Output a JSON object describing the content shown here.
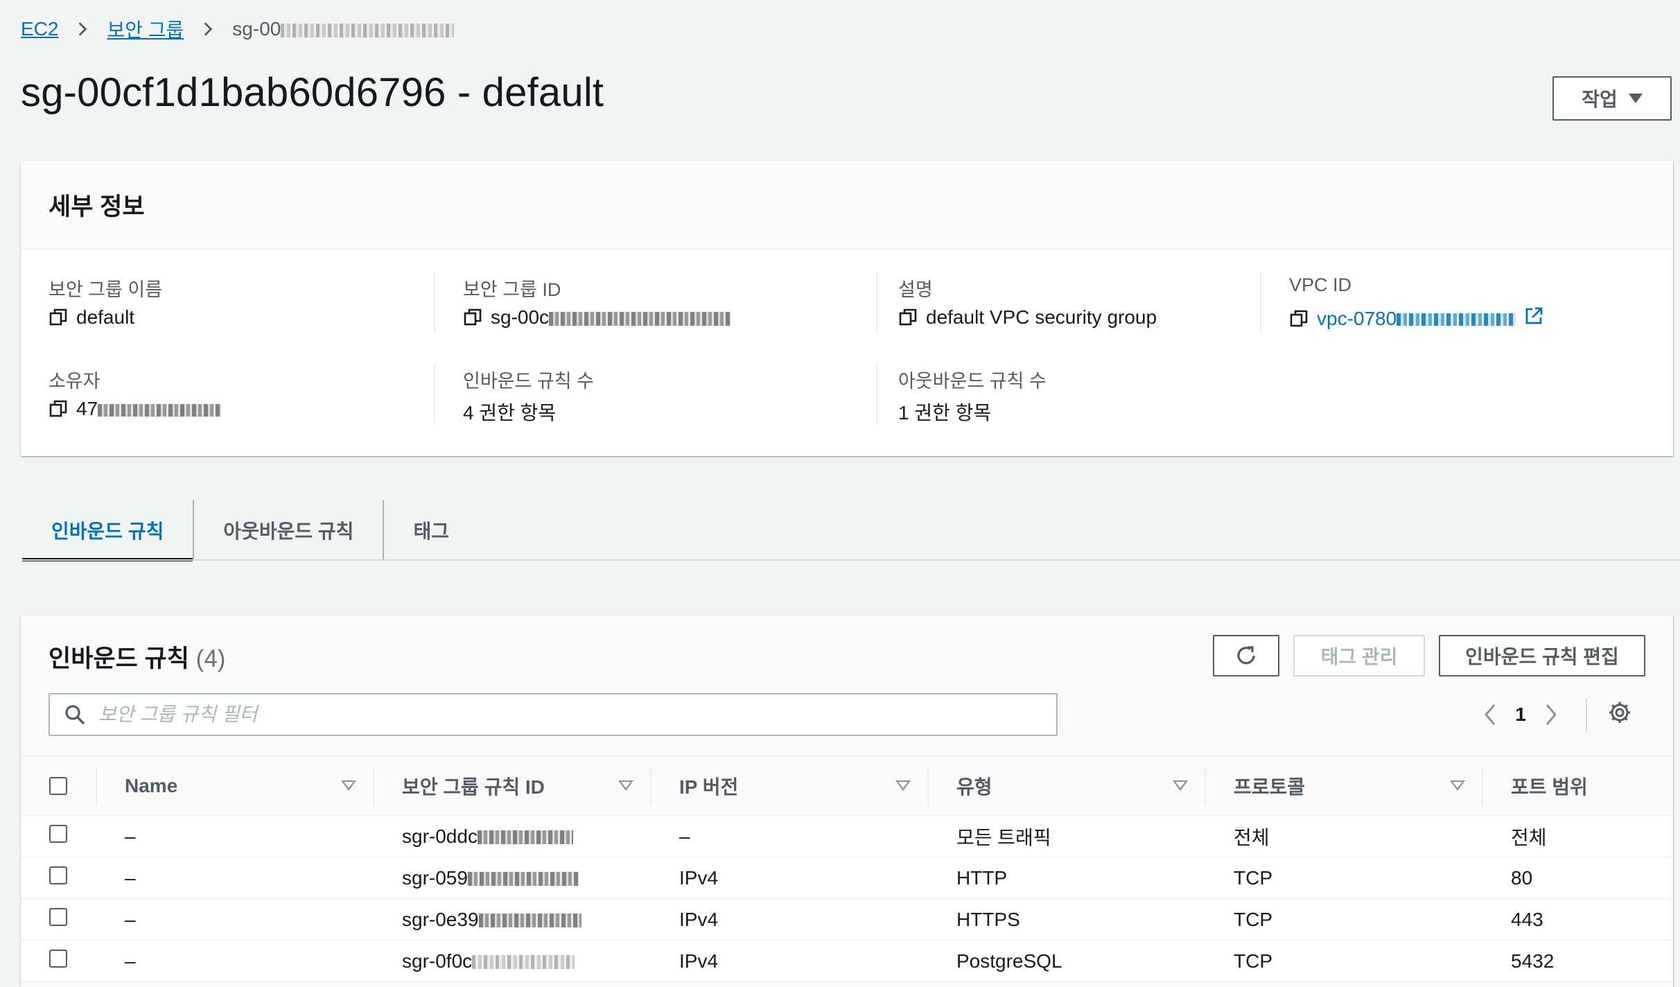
{
  "breadcrumb": {
    "root": "EC2",
    "section": "보안 그룹",
    "current_prefix": "sg-00"
  },
  "page": {
    "title": "sg-00cf1d1bab60d6796 - default",
    "actions_label": "작업"
  },
  "details": {
    "header": "세부 정보",
    "fields": {
      "sg_name_label": "보안 그룹 이름",
      "sg_name_value": "default",
      "sg_id_label": "보안 그룹 ID",
      "sg_id_value": "sg-00c",
      "description_label": "설명",
      "description_value": "default VPC security group",
      "vpc_label": "VPC ID",
      "vpc_value": "vpc-0780",
      "owner_label": "소유자",
      "owner_value": "47",
      "inbound_count_label": "인바운드 규칙 수",
      "inbound_count_value": "4 권한 항목",
      "outbound_count_label": "아웃바운드 규칙 수",
      "outbound_count_value": "1 권한 항목"
    }
  },
  "tabs": [
    {
      "label": "인바운드 규칙",
      "active": true
    },
    {
      "label": "아웃바운드 규칙",
      "active": false
    },
    {
      "label": "태그",
      "active": false
    }
  ],
  "rules_panel": {
    "title": "인바운드 규칙",
    "count": "(4)",
    "manage_tags_label": "태그 관리",
    "edit_rules_label": "인바운드 규칙 편집",
    "search_placeholder": "보안 그룹 규칙 필터",
    "page_number": "1",
    "columns": [
      "Name",
      "보안 그룹 규칙 ID",
      "IP 버전",
      "유형",
      "프로토콜",
      "포트 범위"
    ],
    "rows": [
      {
        "name": "–",
        "rule_id": "sgr-0ddc",
        "ip_version": "–",
        "type": "모든 트래픽",
        "protocol": "전체",
        "port": "전체"
      },
      {
        "name": "–",
        "rule_id": "sgr-059",
        "ip_version": "IPv4",
        "type": "HTTP",
        "protocol": "TCP",
        "port": "80"
      },
      {
        "name": "–",
        "rule_id": "sgr-0e39",
        "ip_version": "IPv4",
        "type": "HTTPS",
        "protocol": "TCP",
        "port": "443"
      },
      {
        "name": "–",
        "rule_id": "sgr-0f0c",
        "ip_version": "IPv4",
        "type": "PostgreSQL",
        "protocol": "TCP",
        "port": "5432"
      }
    ]
  },
  "colors": {
    "link": "#0073bb",
    "background": "#f2f3f3",
    "text": "#16191f",
    "muted": "#545b64"
  },
  "icons": [
    "chevron-right-icon",
    "caret-down-icon",
    "copy-icon",
    "external-link-icon",
    "refresh-icon",
    "search-icon",
    "chevron-left-icon",
    "settings-gear-icon",
    "sort-icon"
  ]
}
